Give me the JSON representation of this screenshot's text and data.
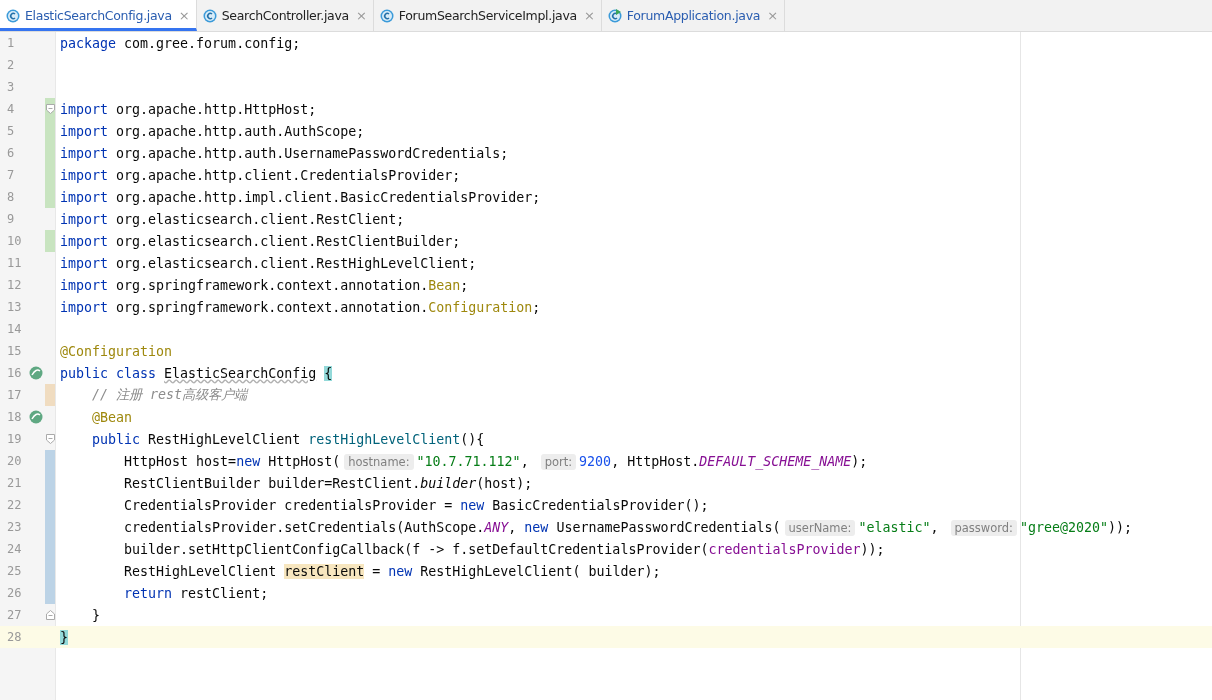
{
  "tabs": [
    {
      "label": "ElasticSearchConfig.java",
      "selected": true,
      "modified": true,
      "kind": "class",
      "close": "×"
    },
    {
      "label": "SearchController.java",
      "selected": false,
      "modified": false,
      "kind": "class",
      "close": "×"
    },
    {
      "label": "ForumSearchServiceImpl.java",
      "selected": false,
      "modified": false,
      "kind": "class",
      "close": "×"
    },
    {
      "label": "ForumApplication.java",
      "selected": false,
      "modified": true,
      "kind": "app",
      "close": "×"
    }
  ],
  "lines": [
    {
      "number": "1",
      "kind": "unchanged",
      "fold_start": false,
      "fold_end": false,
      "bean": false,
      "current": false,
      "segments": [
        {
          "kind": "keyword",
          "text": "package"
        },
        {
          "kind": "plain",
          "text": " com.gree.forum.config;"
        }
      ]
    },
    {
      "number": "2",
      "kind": "unchanged",
      "fold_start": false,
      "fold_end": false,
      "bean": false,
      "current": false
    },
    {
      "number": "3",
      "kind": "unchanged",
      "fold_start": false,
      "fold_end": false,
      "bean": false,
      "current": false
    },
    {
      "number": "4",
      "kind": "added",
      "fold_start": true,
      "fold_end": false,
      "bean": false,
      "current": false,
      "segments": [
        {
          "kind": "keyword",
          "text": "import"
        },
        {
          "kind": "plain",
          "text": " org.apache.http.HttpHost;"
        }
      ]
    },
    {
      "number": "5",
      "kind": "added",
      "fold_start": false,
      "fold_end": false,
      "bean": false,
      "current": false,
      "segments": [
        {
          "kind": "keyword",
          "text": "import"
        },
        {
          "kind": "plain",
          "text": " org.apache.http.auth.AuthScope;"
        }
      ]
    },
    {
      "number": "6",
      "kind": "added",
      "fold_start": false,
      "fold_end": false,
      "bean": false,
      "current": false,
      "segments": [
        {
          "kind": "keyword",
          "text": "import"
        },
        {
          "kind": "plain",
          "text": " org.apache.http.auth.UsernamePasswordCredentials;"
        }
      ]
    },
    {
      "number": "7",
      "kind": "added",
      "fold_start": false,
      "fold_end": false,
      "bean": false,
      "current": false,
      "segments": [
        {
          "kind": "keyword",
          "text": "import"
        },
        {
          "kind": "plain",
          "text": " org.apache.http.client.CredentialsProvider;"
        }
      ]
    },
    {
      "number": "8",
      "kind": "added",
      "fold_start": false,
      "fold_end": false,
      "bean": false,
      "current": false,
      "segments": [
        {
          "kind": "keyword",
          "text": "import"
        },
        {
          "kind": "plain",
          "text": " org.apache.http.impl.client.BasicCredentialsProvider;"
        }
      ]
    },
    {
      "number": "9",
      "kind": "unchanged",
      "fold_start": false,
      "fold_end": false,
      "bean": false,
      "current": false,
      "segments": [
        {
          "kind": "keyword",
          "text": "import"
        },
        {
          "kind": "plain",
          "text": " org.elasticsearch.client.RestClient;"
        }
      ]
    },
    {
      "number": "10",
      "kind": "added",
      "fold_start": false,
      "fold_end": false,
      "bean": false,
      "current": false,
      "segments": [
        {
          "kind": "keyword",
          "text": "import"
        },
        {
          "kind": "plain",
          "text": " org.elasticsearch.client.RestClientBuilder;"
        }
      ]
    },
    {
      "number": "11",
      "kind": "unchanged",
      "fold_start": false,
      "fold_end": false,
      "bean": false,
      "current": false,
      "segments": [
        {
          "kind": "keyword",
          "text": "import"
        },
        {
          "kind": "plain",
          "text": " org.elasticsearch.client.RestHighLevelClient;"
        }
      ]
    },
    {
      "number": "12",
      "kind": "unchanged",
      "fold_start": false,
      "fold_end": false,
      "bean": false,
      "current": false,
      "segments": [
        {
          "kind": "keyword",
          "text": "import"
        },
        {
          "kind": "plain",
          "text": " org.springframework.context.annotation."
        },
        {
          "kind": "annotation",
          "text": "Bean"
        },
        {
          "kind": "plain",
          "text": ";"
        }
      ]
    },
    {
      "number": "13",
      "kind": "unchanged",
      "fold_start": false,
      "fold_end": false,
      "bean": false,
      "current": false,
      "segments": [
        {
          "kind": "keyword",
          "text": "import"
        },
        {
          "kind": "plain",
          "text": " org.springframework.context.annotation."
        },
        {
          "kind": "annotation",
          "text": "Configuration"
        },
        {
          "kind": "plain",
          "text": ";"
        }
      ]
    },
    {
      "number": "14",
      "kind": "unchanged",
      "fold_start": false,
      "fold_end": false,
      "bean": false,
      "current": false
    },
    {
      "number": "15",
      "kind": "unchanged",
      "fold_start": false,
      "fold_end": false,
      "bean": false,
      "current": false,
      "segments": [
        {
          "kind": "annotation",
          "text": "@Configuration"
        }
      ]
    },
    {
      "number": "16",
      "kind": "unchanged",
      "fold_start": false,
      "fold_end": false,
      "bean": true,
      "current": false,
      "segments": [
        {
          "kind": "keyword",
          "text": "public class "
        },
        {
          "kind": "typo",
          "text": "ElasticSearchConfig"
        },
        {
          "kind": "brace",
          "text": "{"
        }
      ]
    },
    {
      "number": "17",
      "kind": "edited",
      "fold_start": false,
      "fold_end": false,
      "bean": false,
      "current": false,
      "segments": [
        {
          "kind": "comment",
          "text": "    // 注册 rest高级客户端"
        }
      ]
    },
    {
      "number": "18",
      "kind": "unchanged",
      "fold_start": false,
      "fold_end": false,
      "bean": true,
      "current": false,
      "segments": [
        {
          "kind": "annotation",
          "text": "    @Bean"
        }
      ]
    },
    {
      "number": "19",
      "kind": "unchanged",
      "fold_start": true,
      "fold_end": false,
      "bean": false,
      "current": false,
      "segments": [
        {
          "kind": "keyword",
          "text": "    public"
        },
        {
          "kind": "plain",
          "text": " RestHighLevelClient "
        },
        {
          "kind": "method",
          "text": "restHighLevelClient"
        },
        {
          "kind": "plain",
          "text": "(){"
        }
      ]
    },
    {
      "number": "20",
      "kind": "modified",
      "fold_start": false,
      "fold_end": false,
      "bean": false,
      "current": false,
      "segments": [
        {
          "kind": "plain",
          "text": "        HttpHost host="
        },
        {
          "kind": "keyword",
          "text": "new"
        },
        {
          "kind": "plain",
          "text": " HttpHost("
        },
        {
          "kind": "hint",
          "text": "hostname:"
        },
        {
          "kind": "string",
          "text": "\"10.7.71.112\""
        },
        {
          "kind": "plain",
          "text": ", "
        },
        {
          "kind": "hint",
          "text": "port:"
        },
        {
          "kind": "number",
          "text": "9200"
        },
        {
          "kind": "plain",
          "text": ", HttpHost."
        },
        {
          "kind": "static",
          "text": "DEFAULT_SCHEME_NAME"
        },
        {
          "kind": "plain",
          "text": ");"
        }
      ]
    },
    {
      "number": "21",
      "kind": "modified",
      "fold_start": false,
      "fold_end": false,
      "bean": false,
      "current": false,
      "segments": [
        {
          "kind": "plain",
          "text": "        RestClientBuilder builder=RestClient."
        },
        {
          "kind": "italic",
          "text": "builder"
        },
        {
          "kind": "plain",
          "text": "(host);"
        }
      ]
    },
    {
      "number": "22",
      "kind": "modified",
      "fold_start": false,
      "fold_end": false,
      "bean": false,
      "current": false,
      "segments": [
        {
          "kind": "plain",
          "text": "        CredentialsProvider credentialsProvider = "
        },
        {
          "kind": "keyword",
          "text": "new"
        },
        {
          "kind": "plain",
          "text": " BasicCredentialsProvider();"
        }
      ]
    },
    {
      "number": "23",
      "kind": "modified",
      "fold_start": false,
      "fold_end": false,
      "bean": false,
      "current": false,
      "segments": [
        {
          "kind": "plain",
          "text": "        credentialsProvider.setCredentials(AuthScope."
        },
        {
          "kind": "static",
          "text": "ANY"
        },
        {
          "kind": "plain",
          "text": ", "
        },
        {
          "kind": "keyword",
          "text": "new"
        },
        {
          "kind": "plain",
          "text": " UsernamePasswordCredentials("
        },
        {
          "kind": "hint",
          "text": "userName:"
        },
        {
          "kind": "string",
          "text": "\"elastic\""
        },
        {
          "kind": "plain",
          "text": ", "
        },
        {
          "kind": "hint",
          "text": "password:"
        },
        {
          "kind": "string",
          "text": "\"gree@2020\""
        },
        {
          "kind": "plain",
          "text": "));"
        }
      ]
    },
    {
      "number": "24",
      "kind": "modified",
      "fold_start": false,
      "fold_end": false,
      "bean": false,
      "current": false,
      "segments": [
        {
          "kind": "plain",
          "text": "        builder.setHttpClientConfigCallback(f -> f.setDefaultCredentialsProvider("
        },
        {
          "kind": "field",
          "text": "credentialsProvider"
        },
        {
          "kind": "plain",
          "text": "));"
        }
      ]
    },
    {
      "number": "25",
      "kind": "modified",
      "fold_start": false,
      "fold_end": false,
      "bean": false,
      "current": false,
      "segments": [
        {
          "kind": "plain",
          "text": "        RestHighLevelClient "
        },
        {
          "kind": "usage",
          "text": "restClient"
        },
        {
          "kind": "plain",
          "text": " = "
        },
        {
          "kind": "keyword",
          "text": "new"
        },
        {
          "kind": "plain",
          "text": " RestHighLevelClient( builder);"
        }
      ]
    },
    {
      "number": "26",
      "kind": "modified",
      "fold_start": false,
      "fold_end": false,
      "bean": false,
      "current": false,
      "segments": [
        {
          "kind": "keyword",
          "text": "        return"
        },
        {
          "kind": "plain",
          "text": " restClient;"
        }
      ]
    },
    {
      "number": "27",
      "kind": "unchanged",
      "fold_start": false,
      "fold_end": true,
      "bean": false,
      "current": false,
      "segments": [
        {
          "kind": "plain",
          "text": "    }"
        }
      ]
    },
    {
      "number": "28",
      "kind": "unchanged",
      "fold_start": false,
      "fold_end": false,
      "bean": false,
      "current": true,
      "segments": [
        {
          "kind": "brace",
          "text": "}"
        }
      ]
    }
  ]
}
